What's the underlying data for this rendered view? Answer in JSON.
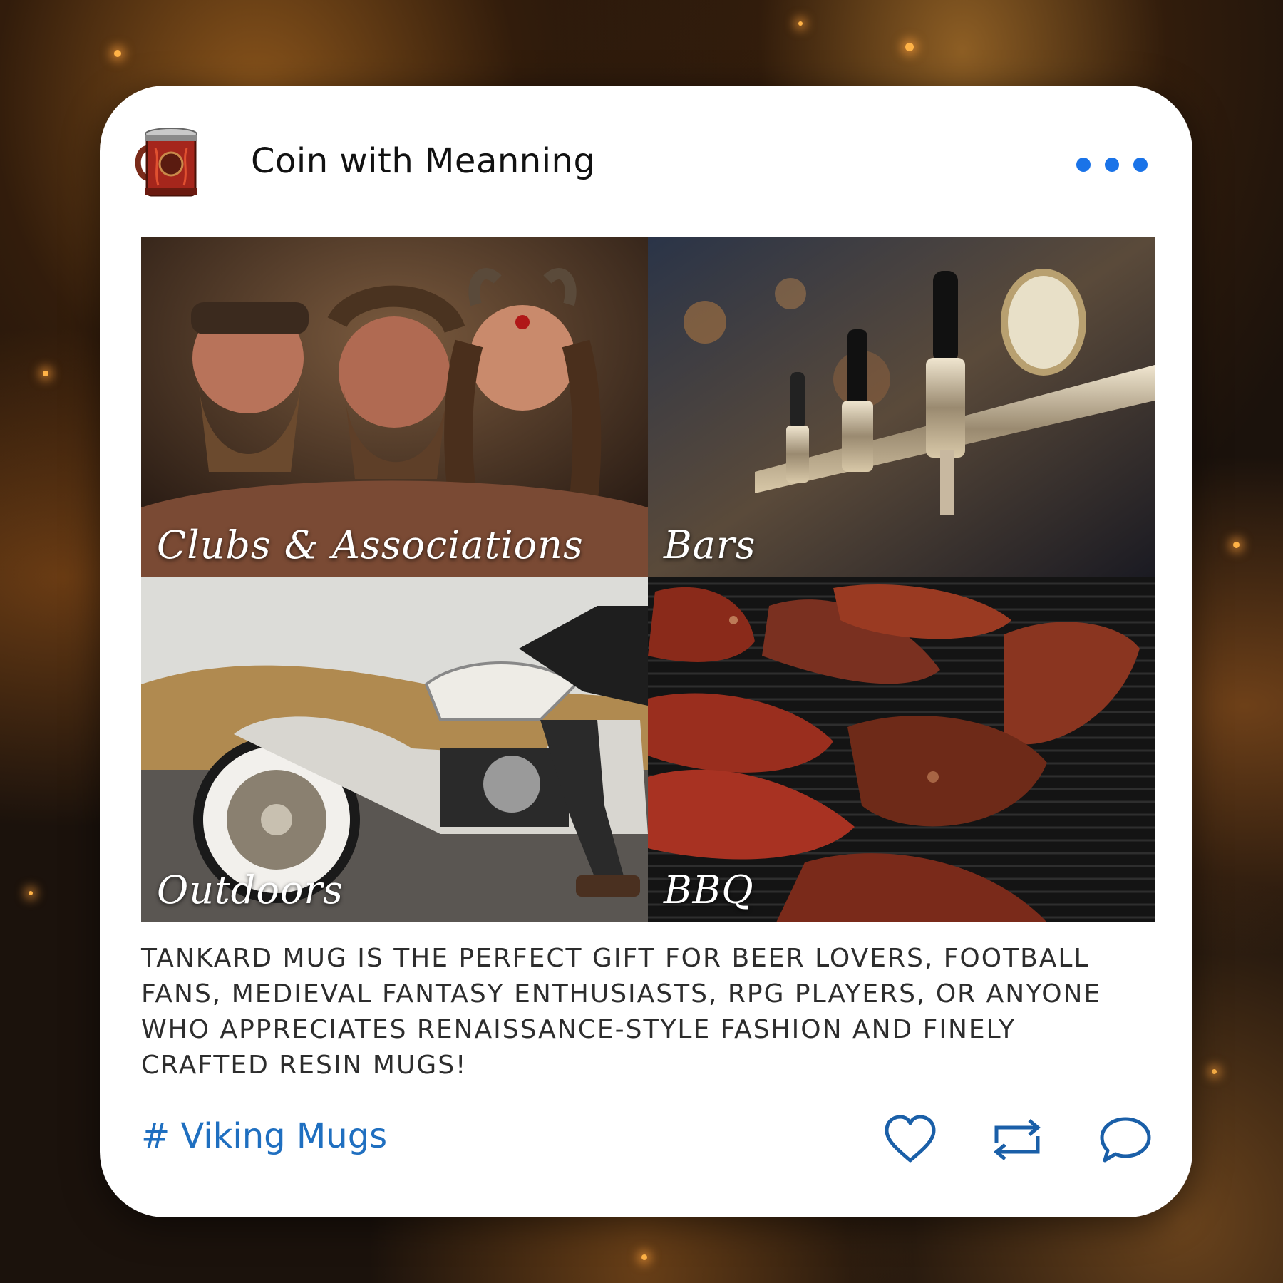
{
  "post": {
    "account_name": "Coin with Meanning",
    "avatar_icon": "tankard-mug-icon",
    "more_icon": "more-dots-icon",
    "accent_color": "#1a73e8"
  },
  "tiles": [
    {
      "label": "Clubs & Associations",
      "scene": "smiling viking-costumed friends"
    },
    {
      "label": "Bars",
      "scene": "chrome beer taps in a bar"
    },
    {
      "label": "Outdoors",
      "scene": "rider on a white motorcycle"
    },
    {
      "label": "BBQ",
      "scene": "steaks grilling on a barbecue"
    }
  ],
  "caption": "TANKARD MUG IS THE PERFECT GIFT FOR BEER LOVERS, FOOTBALL FANS, MEDIEVAL FANTASY ENTHUSIASTS, RPG PLAYERS, OR ANYONE WHO APPRECIATES RENAISSANCE-STYLE FASHION AND FINELY CRAFTED RESIN MUGS!",
  "hashtag": "# Viking Mugs",
  "actions": [
    "heart-icon",
    "repost-icon",
    "comment-icon"
  ],
  "colors": {
    "link": "#1f6fc0",
    "icon": "#1a5fa8"
  }
}
